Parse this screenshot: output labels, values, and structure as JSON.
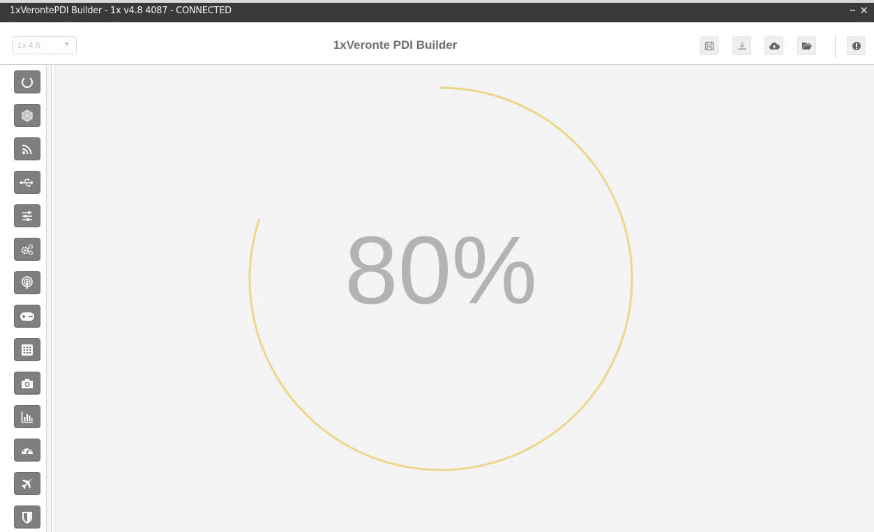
{
  "window": {
    "title": "1xVerontePDI Builder - 1x v4.8 4087 - CONNECTED"
  },
  "toolbar": {
    "version_select": "1x 4.8",
    "app_title": "1xVeronte PDI Builder",
    "buttons": [
      {
        "name": "save",
        "icon": "floppy-disk-icon"
      },
      {
        "name": "download",
        "icon": "download-tray-icon"
      },
      {
        "name": "cloud",
        "icon": "cloud-upload-icon"
      },
      {
        "name": "open-folder",
        "icon": "folder-open-icon"
      },
      {
        "name": "info",
        "icon": "exclamation-circle-icon"
      }
    ]
  },
  "sidebar": {
    "items": [
      {
        "icon": "power-ring-icon"
      },
      {
        "icon": "hexagon-network-icon"
      },
      {
        "icon": "rss-signal-icon"
      },
      {
        "icon": "usb-icon"
      },
      {
        "icon": "sliders-icon"
      },
      {
        "icon": "gears-icon"
      },
      {
        "icon": "podcast-antenna-icon"
      },
      {
        "icon": "gamepad-icon"
      },
      {
        "icon": "grid-keypad-icon"
      },
      {
        "icon": "camera-icon"
      },
      {
        "icon": "bar-chart-icon"
      },
      {
        "icon": "gauge-dashboard-icon"
      },
      {
        "icon": "airplane-icon"
      },
      {
        "icon": "shield-icon"
      }
    ]
  },
  "main": {
    "progress_label": "80%",
    "progress_fraction": 0.8,
    "arc_color": "#ecd68a"
  },
  "colors": {
    "titlebar": "#3a3a3a",
    "sidebar_button": "#7f7f7f",
    "background": "#f3f3f3"
  }
}
